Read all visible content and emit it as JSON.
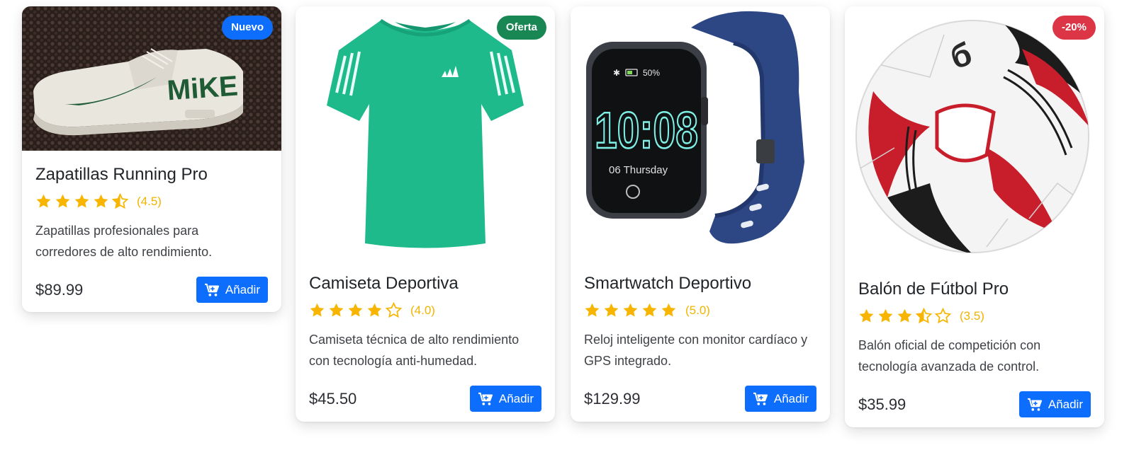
{
  "colors": {
    "primary": "#0d6efd",
    "star": "#f7b500",
    "badge_new": "#0d6efd",
    "badge_offer": "#198754",
    "badge_discount": "#dc3545"
  },
  "products": [
    {
      "badge": "Nuevo",
      "image_icon": "sneaker-image",
      "title": "Zapatillas Running Pro",
      "rating": 4.5,
      "rating_label": "(4.5)",
      "description": "Zapatillas profesionales para corredores de alto rendimiento.",
      "price": "$89.99",
      "button_label": "Añadir"
    },
    {
      "badge": "Oferta",
      "image_icon": "tshirt-image",
      "title": "Camiseta Deportiva",
      "rating": 4.0,
      "rating_label": "(4.0)",
      "description": "Camiseta técnica de alto rendimiento con tecnología anti-humedad.",
      "price": "$45.50",
      "button_label": "Añadir"
    },
    {
      "badge": "",
      "image_icon": "smartwatch-image",
      "image_text": {
        "battery": "50%",
        "time": "10:08",
        "date": "06 Thursday"
      },
      "title": "Smartwatch Deportivo",
      "rating": 5.0,
      "rating_label": "(5.0)",
      "description": "Reloj inteligente con monitor cardíaco y GPS integrado.",
      "price": "$129.99",
      "button_label": "Añadir"
    },
    {
      "badge": "-20%",
      "image_icon": "soccer-ball-image",
      "title": "Balón de Fútbol Pro",
      "rating": 3.5,
      "rating_label": "(3.5)",
      "description": "Balón oficial de competición con tecnología avanzada de control.",
      "price": "$35.99",
      "button_label": "Añadir"
    }
  ]
}
